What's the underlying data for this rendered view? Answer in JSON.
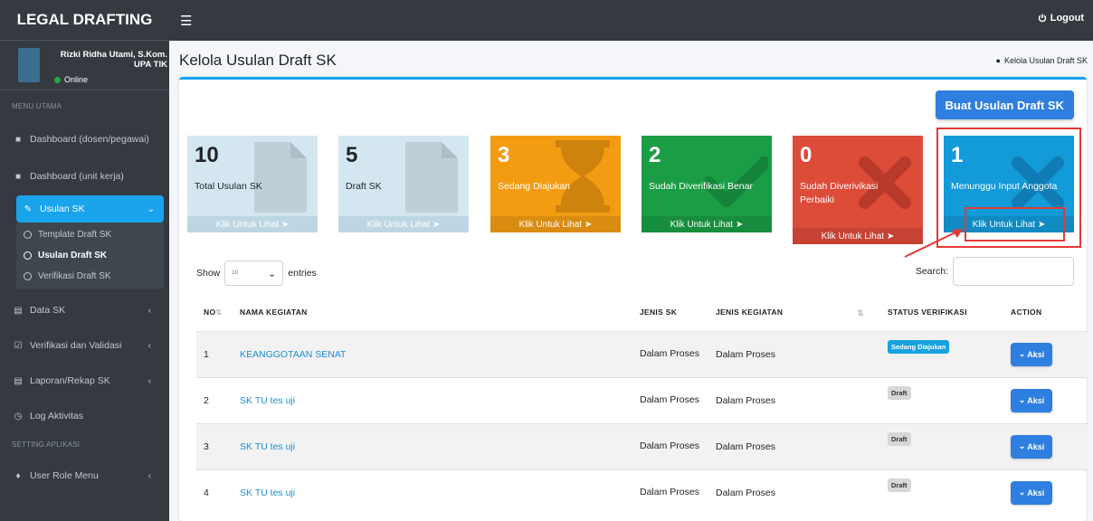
{
  "brand": "LEGAL DRAFTING",
  "topbar": {
    "logout_label": "Logout"
  },
  "user": {
    "name": "Rizki Ridha Utami, S.Kom. UPA TIK",
    "status": "Online"
  },
  "sidebar": {
    "header_main": "MENU UTAMA",
    "header_setting": "SETTING APLIKASI",
    "items": [
      {
        "label": "Dashboard (dosen/pegawai)",
        "icon": "file-icon"
      },
      {
        "label": "Dashboard (unit kerja)",
        "icon": "file-icon"
      },
      {
        "label": "Usulan SK",
        "icon": "edit-icon",
        "active": true
      },
      {
        "label": "Data SK",
        "icon": "id-card-icon"
      },
      {
        "label": "Verifikasi dan Validasi",
        "icon": "check-square-icon"
      },
      {
        "label": "Laporan/Rekap SK",
        "icon": "document-icon"
      },
      {
        "label": "Log Aktivitas",
        "icon": "clock-icon"
      },
      {
        "label": "User Role Menu",
        "icon": "tags-icon"
      }
    ],
    "subitems": [
      {
        "label": "Template Draft SK"
      },
      {
        "label": "Usulan Draft SK",
        "active": true
      },
      {
        "label": "Verifikasi Draft SK"
      }
    ]
  },
  "page": {
    "title": "Kelola Usulan Draft SK",
    "breadcrumb": "Kelola Usulan Draft SK",
    "create_button": "Buat Usulan Draft SK"
  },
  "boxes": [
    {
      "number": "10",
      "label": "Total Usulan SK",
      "footer": "Klik Untuk Lihat",
      "color": "#d4e7f1"
    },
    {
      "number": "5",
      "label": "Draft SK",
      "footer": "Klik Untuk Lihat",
      "color": "#d4e7f1"
    },
    {
      "number": "3",
      "label": "Sedang Diajukan",
      "footer": "Klik Untuk Lihat",
      "color": "#f39c12"
    },
    {
      "number": "2",
      "label": "Sudah Diverifikasi Benar",
      "footer": "Klik Untuk Lihat",
      "color": "#1a9d45"
    },
    {
      "number": "0",
      "label": "Sudah Diverivikasi Perbaiki",
      "footer": "Klik Untuk Lihat",
      "color": "#dd4b39"
    },
    {
      "number": "1",
      "label": "Menunggu Input Anggota",
      "footer": "Klik Untuk Lihat",
      "color": "#139ad8"
    }
  ],
  "table_controls": {
    "show_label": "Show",
    "entries_label": "entries",
    "page_size": "10",
    "search_label": "Search:"
  },
  "table": {
    "headers": [
      "NO",
      "NAMA KEGIATAN",
      "JENIS SK",
      "JENIS KEGIATAN",
      "STATUS VERIFIKASI",
      "ACTION"
    ],
    "rows": [
      {
        "no": "1",
        "nama": "KEANGGOTAAN SENAT",
        "jenis_sk": "Dalam Proses",
        "jenis_kegiatan": "Dalam Proses",
        "status": "Sedang Diajukan",
        "action": "Aksi"
      },
      {
        "no": "2",
        "nama": "SK TU tes uji",
        "jenis_sk": "Dalam Proses",
        "jenis_kegiatan": "Dalam Proses",
        "status": "Draft",
        "action": "Aksi"
      },
      {
        "no": "3",
        "nama": "SK TU tes uji",
        "jenis_sk": "Dalam Proses",
        "jenis_kegiatan": "Dalam Proses",
        "status": "Draft",
        "action": "Aksi"
      },
      {
        "no": "4",
        "nama": "SK TU tes uji",
        "jenis_sk": "Dalam Proses",
        "jenis_kegiatan": "Dalam Proses",
        "status": "Draft",
        "action": "Aksi"
      }
    ]
  }
}
